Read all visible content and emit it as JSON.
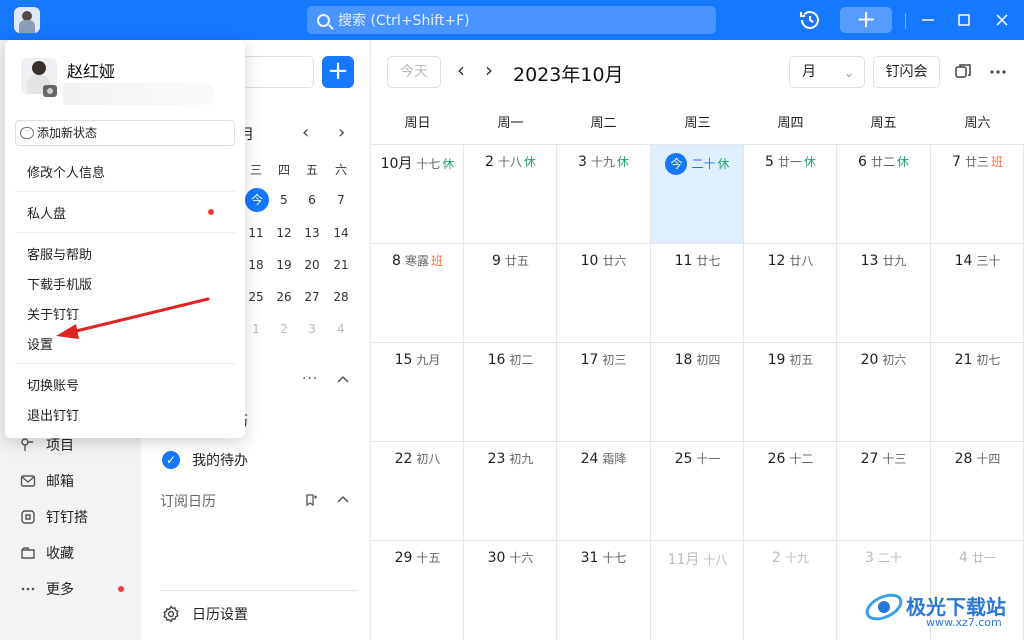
{
  "titlebar": {
    "search_placeholder": "搜索 (Ctrl+Shift+F)",
    "new_button": "+"
  },
  "leftnav": {
    "items": [
      {
        "label": "项目",
        "icon": "project-icon"
      },
      {
        "label": "邮箱",
        "icon": "mail-icon"
      },
      {
        "label": "钉钉搭",
        "icon": "app-builder-icon"
      },
      {
        "label": "收藏",
        "icon": "favorites-icon"
      },
      {
        "label": "更多",
        "icon": "more-icon",
        "has_dot": true
      }
    ]
  },
  "sidepanel": {
    "add_button": "+",
    "mini_calendar": {
      "header": "月",
      "weekday_headers": [
        "三",
        "四",
        "五",
        "六"
      ],
      "rows": [
        [
          "今",
          "5",
          "6",
          "7"
        ],
        [
          "11",
          "12",
          "13",
          "14"
        ],
        [
          "18",
          "19",
          "20",
          "21"
        ],
        [
          "25",
          "26",
          "27",
          "28"
        ],
        [
          "1",
          "2",
          "3",
          "4"
        ]
      ]
    },
    "section_fragment": "历",
    "todo_label": "我的待办",
    "subscribed_label": "订阅日历",
    "settings_label": "日历设置"
  },
  "toolbar": {
    "today_button": "今天",
    "month_title": "2023年10月",
    "view_select": "月",
    "flash_meeting": "钉闪会"
  },
  "calendar": {
    "weekdays": [
      "周日",
      "周一",
      "周二",
      "周三",
      "周四",
      "周五",
      "周六"
    ],
    "weeks": [
      [
        {
          "date": "10月",
          "lunar": "十七",
          "tag": "休",
          "tag_type": "rest"
        },
        {
          "date": "2",
          "lunar": "十八",
          "tag": "休",
          "tag_type": "rest"
        },
        {
          "date": "3",
          "lunar": "十九",
          "tag": "休",
          "tag_type": "rest"
        },
        {
          "date": "今",
          "lunar": "二十",
          "tag": "休",
          "tag_type": "rest",
          "today": true
        },
        {
          "date": "5",
          "lunar": "廿一",
          "tag": "休",
          "tag_type": "rest"
        },
        {
          "date": "6",
          "lunar": "廿二",
          "tag": "休",
          "tag_type": "rest"
        },
        {
          "date": "7",
          "lunar": "廿三",
          "tag": "班",
          "tag_type": "work"
        }
      ],
      [
        {
          "date": "8",
          "lunar": "寒露",
          "tag": "班",
          "tag_type": "work"
        },
        {
          "date": "9",
          "lunar": "廿五"
        },
        {
          "date": "10",
          "lunar": "廿六"
        },
        {
          "date": "11",
          "lunar": "廿七"
        },
        {
          "date": "12",
          "lunar": "廿八"
        },
        {
          "date": "13",
          "lunar": "廿九"
        },
        {
          "date": "14",
          "lunar": "三十"
        }
      ],
      [
        {
          "date": "15",
          "lunar": "九月"
        },
        {
          "date": "16",
          "lunar": "初二"
        },
        {
          "date": "17",
          "lunar": "初三"
        },
        {
          "date": "18",
          "lunar": "初四"
        },
        {
          "date": "19",
          "lunar": "初五"
        },
        {
          "date": "20",
          "lunar": "初六"
        },
        {
          "date": "21",
          "lunar": "初七"
        }
      ],
      [
        {
          "date": "22",
          "lunar": "初八"
        },
        {
          "date": "23",
          "lunar": "初九"
        },
        {
          "date": "24",
          "lunar": "霜降"
        },
        {
          "date": "25",
          "lunar": "十一"
        },
        {
          "date": "26",
          "lunar": "十二"
        },
        {
          "date": "27",
          "lunar": "十三"
        },
        {
          "date": "28",
          "lunar": "十四"
        }
      ],
      [
        {
          "date": "29",
          "lunar": "十五"
        },
        {
          "date": "30",
          "lunar": "十六"
        },
        {
          "date": "31",
          "lunar": "十七"
        },
        {
          "date": "11月",
          "lunar": "十八",
          "other": true
        },
        {
          "date": "2",
          "lunar": "十九",
          "other": true
        },
        {
          "date": "3",
          "lunar": "二十",
          "other": true
        },
        {
          "date": "4",
          "lunar": "廿一",
          "other": true
        }
      ]
    ]
  },
  "popup": {
    "user_name": "赵红娅",
    "add_status": "添加新状态",
    "menu": {
      "edit_profile": "修改个人信息",
      "private_drive": "私人盘",
      "support": "客服与帮助",
      "download_mobile": "下载手机版",
      "about": "关于钉钉",
      "settings": "设置",
      "switch_account": "切换账号",
      "logout": "退出钉钉"
    }
  },
  "watermark": {
    "name": "极光下载站",
    "url": "www.xz7.com"
  },
  "colors": {
    "brand": "#1677ff",
    "rest": "#21a66a",
    "work": "#f77234",
    "annotation_arrow": "#e02424"
  }
}
